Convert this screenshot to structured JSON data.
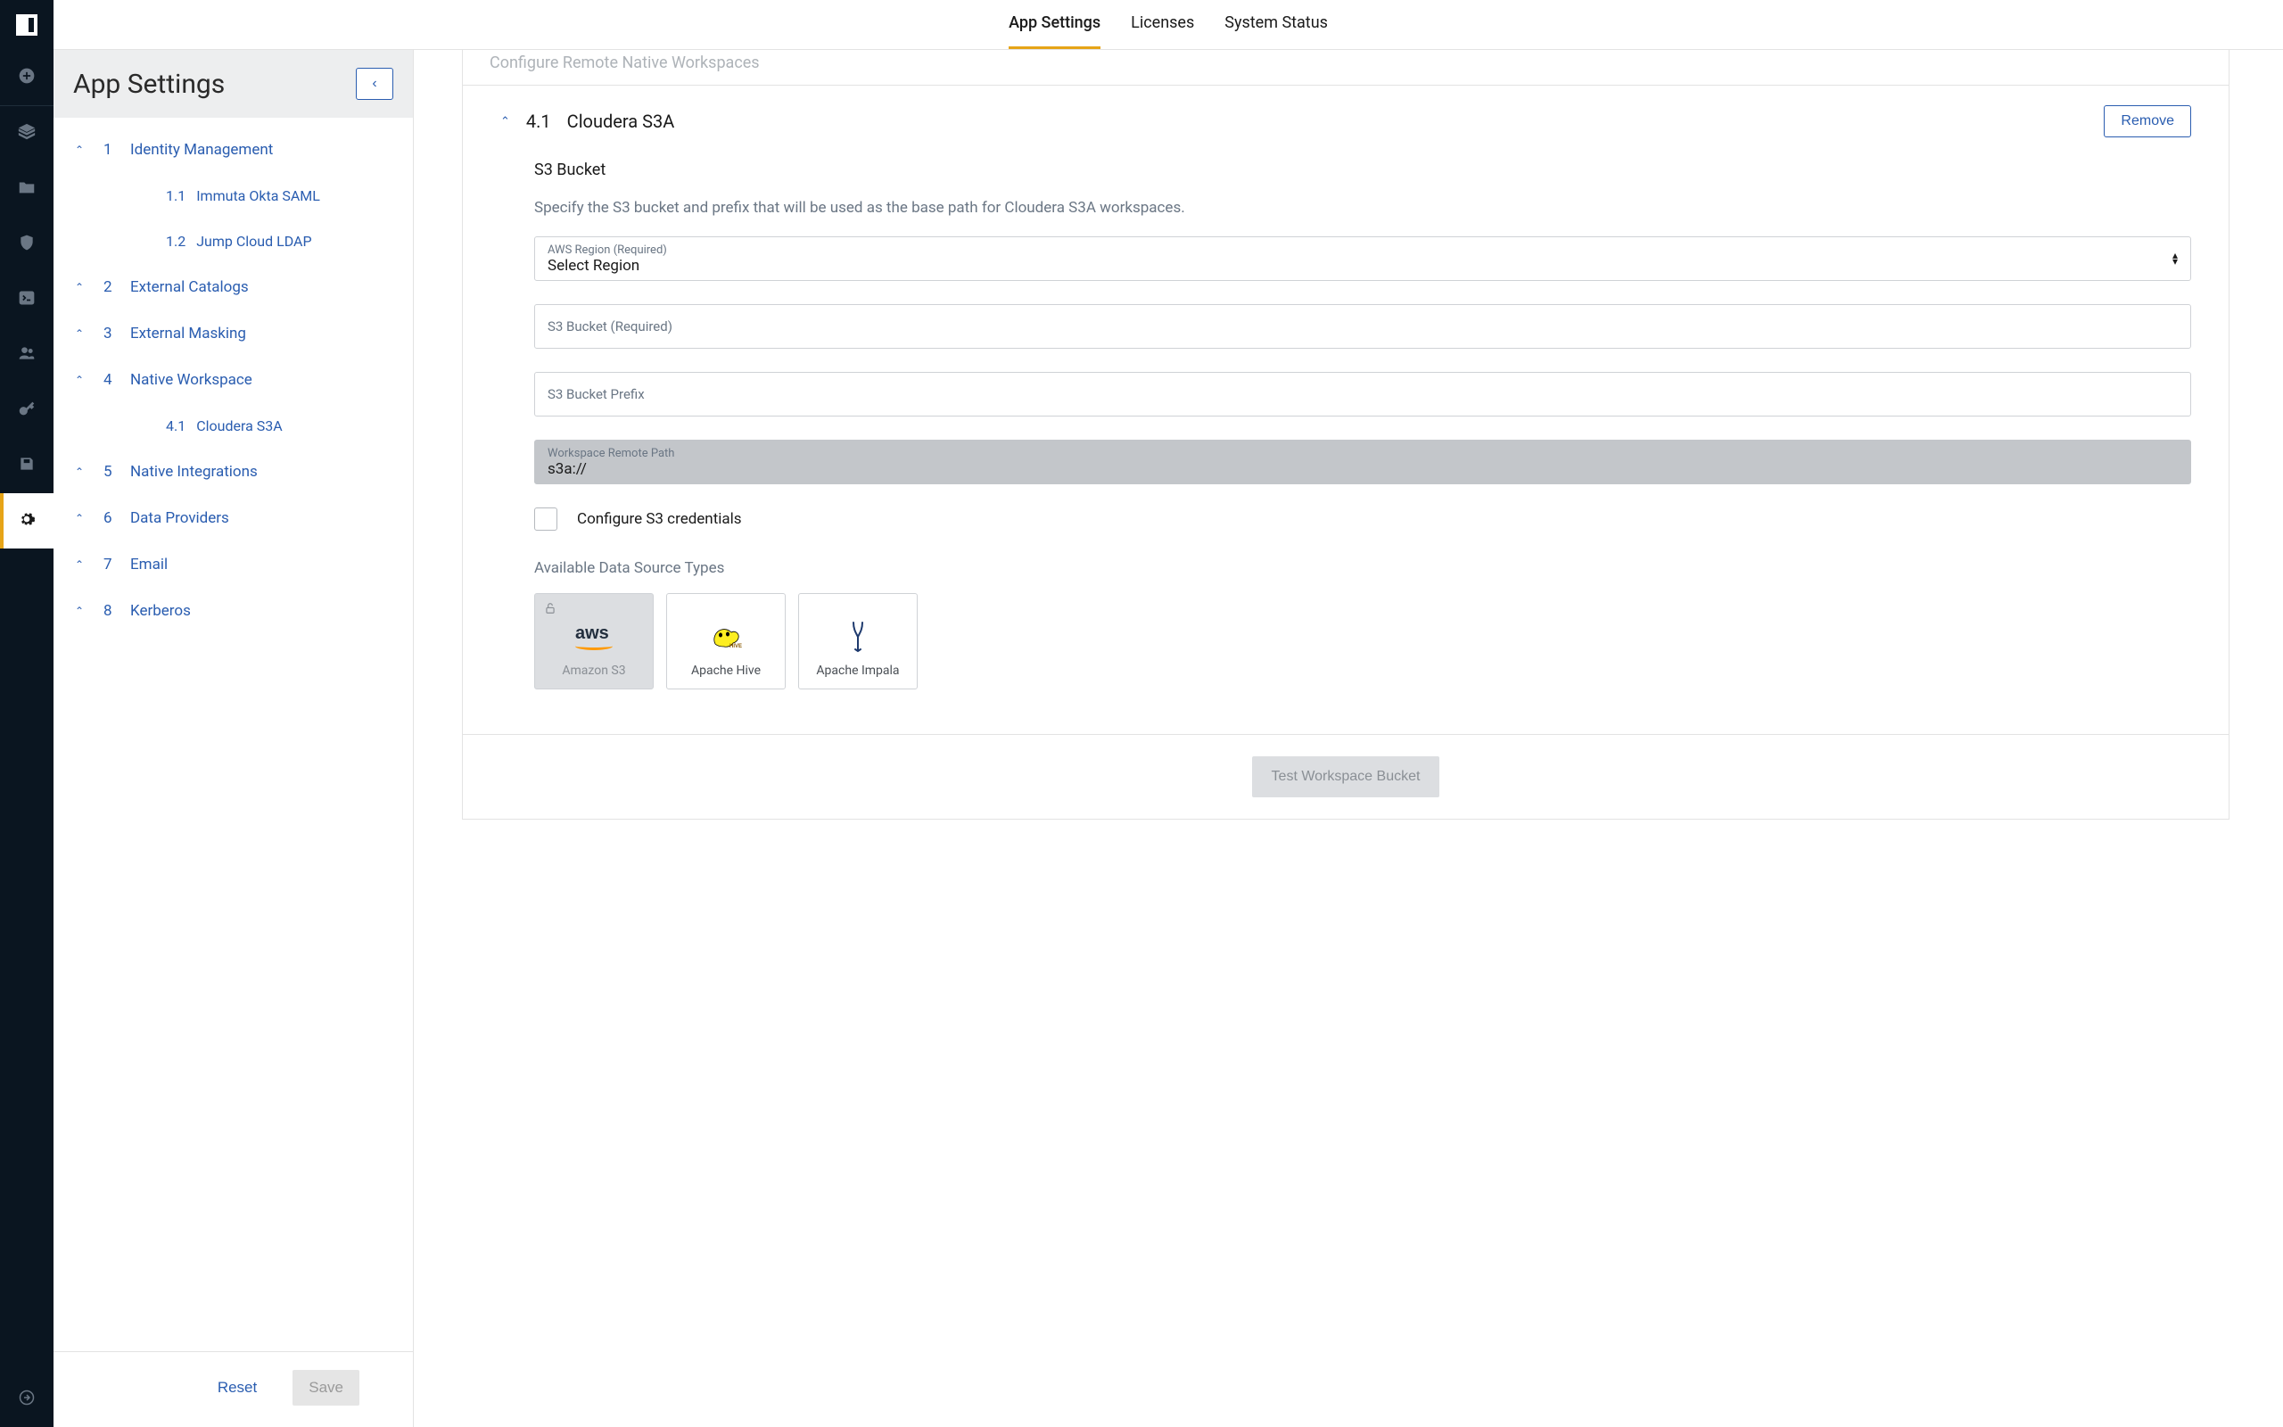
{
  "top_tabs": {
    "app_settings": "App Settings",
    "licenses": "Licenses",
    "system_status": "System Status"
  },
  "sidebar": {
    "title": "App Settings",
    "items": [
      {
        "num": "1",
        "label": "Identity Management",
        "children": [
          {
            "num": "1.1",
            "label": "Immuta Okta SAML"
          },
          {
            "num": "1.2",
            "label": "Jump Cloud LDAP"
          }
        ]
      },
      {
        "num": "2",
        "label": "External Catalogs"
      },
      {
        "num": "3",
        "label": "External Masking"
      },
      {
        "num": "4",
        "label": "Native Workspace",
        "children": [
          {
            "num": "4.1",
            "label": "Cloudera S3A"
          }
        ]
      },
      {
        "num": "5",
        "label": "Native Integrations"
      },
      {
        "num": "6",
        "label": "Data Providers"
      },
      {
        "num": "7",
        "label": "Email"
      },
      {
        "num": "8",
        "label": "Kerberos"
      }
    ],
    "reset": "Reset",
    "save": "Save"
  },
  "main": {
    "prev_section": "Configure Remote Native Workspaces",
    "section_num": "4.1",
    "section_title": "Cloudera S3A",
    "remove": "Remove",
    "sub_heading": "S3 Bucket",
    "sub_desc": "Specify the S3 bucket and prefix that will be used as the base path for Cloudera S3A workspaces.",
    "fields": {
      "region_label": "AWS Region (Required)",
      "region_value": "Select Region",
      "bucket_label": "S3 Bucket (Required)",
      "prefix_label": "S3 Bucket Prefix",
      "path_label": "Workspace Remote Path",
      "path_value": "s3a://"
    },
    "configure_creds": "Configure S3 credentials",
    "ds_title": "Available Data Source Types",
    "ds": {
      "s3": "Amazon S3",
      "hive": "Apache Hive",
      "impala": "Apache Impala"
    },
    "test_btn": "Test Workspace Bucket"
  }
}
